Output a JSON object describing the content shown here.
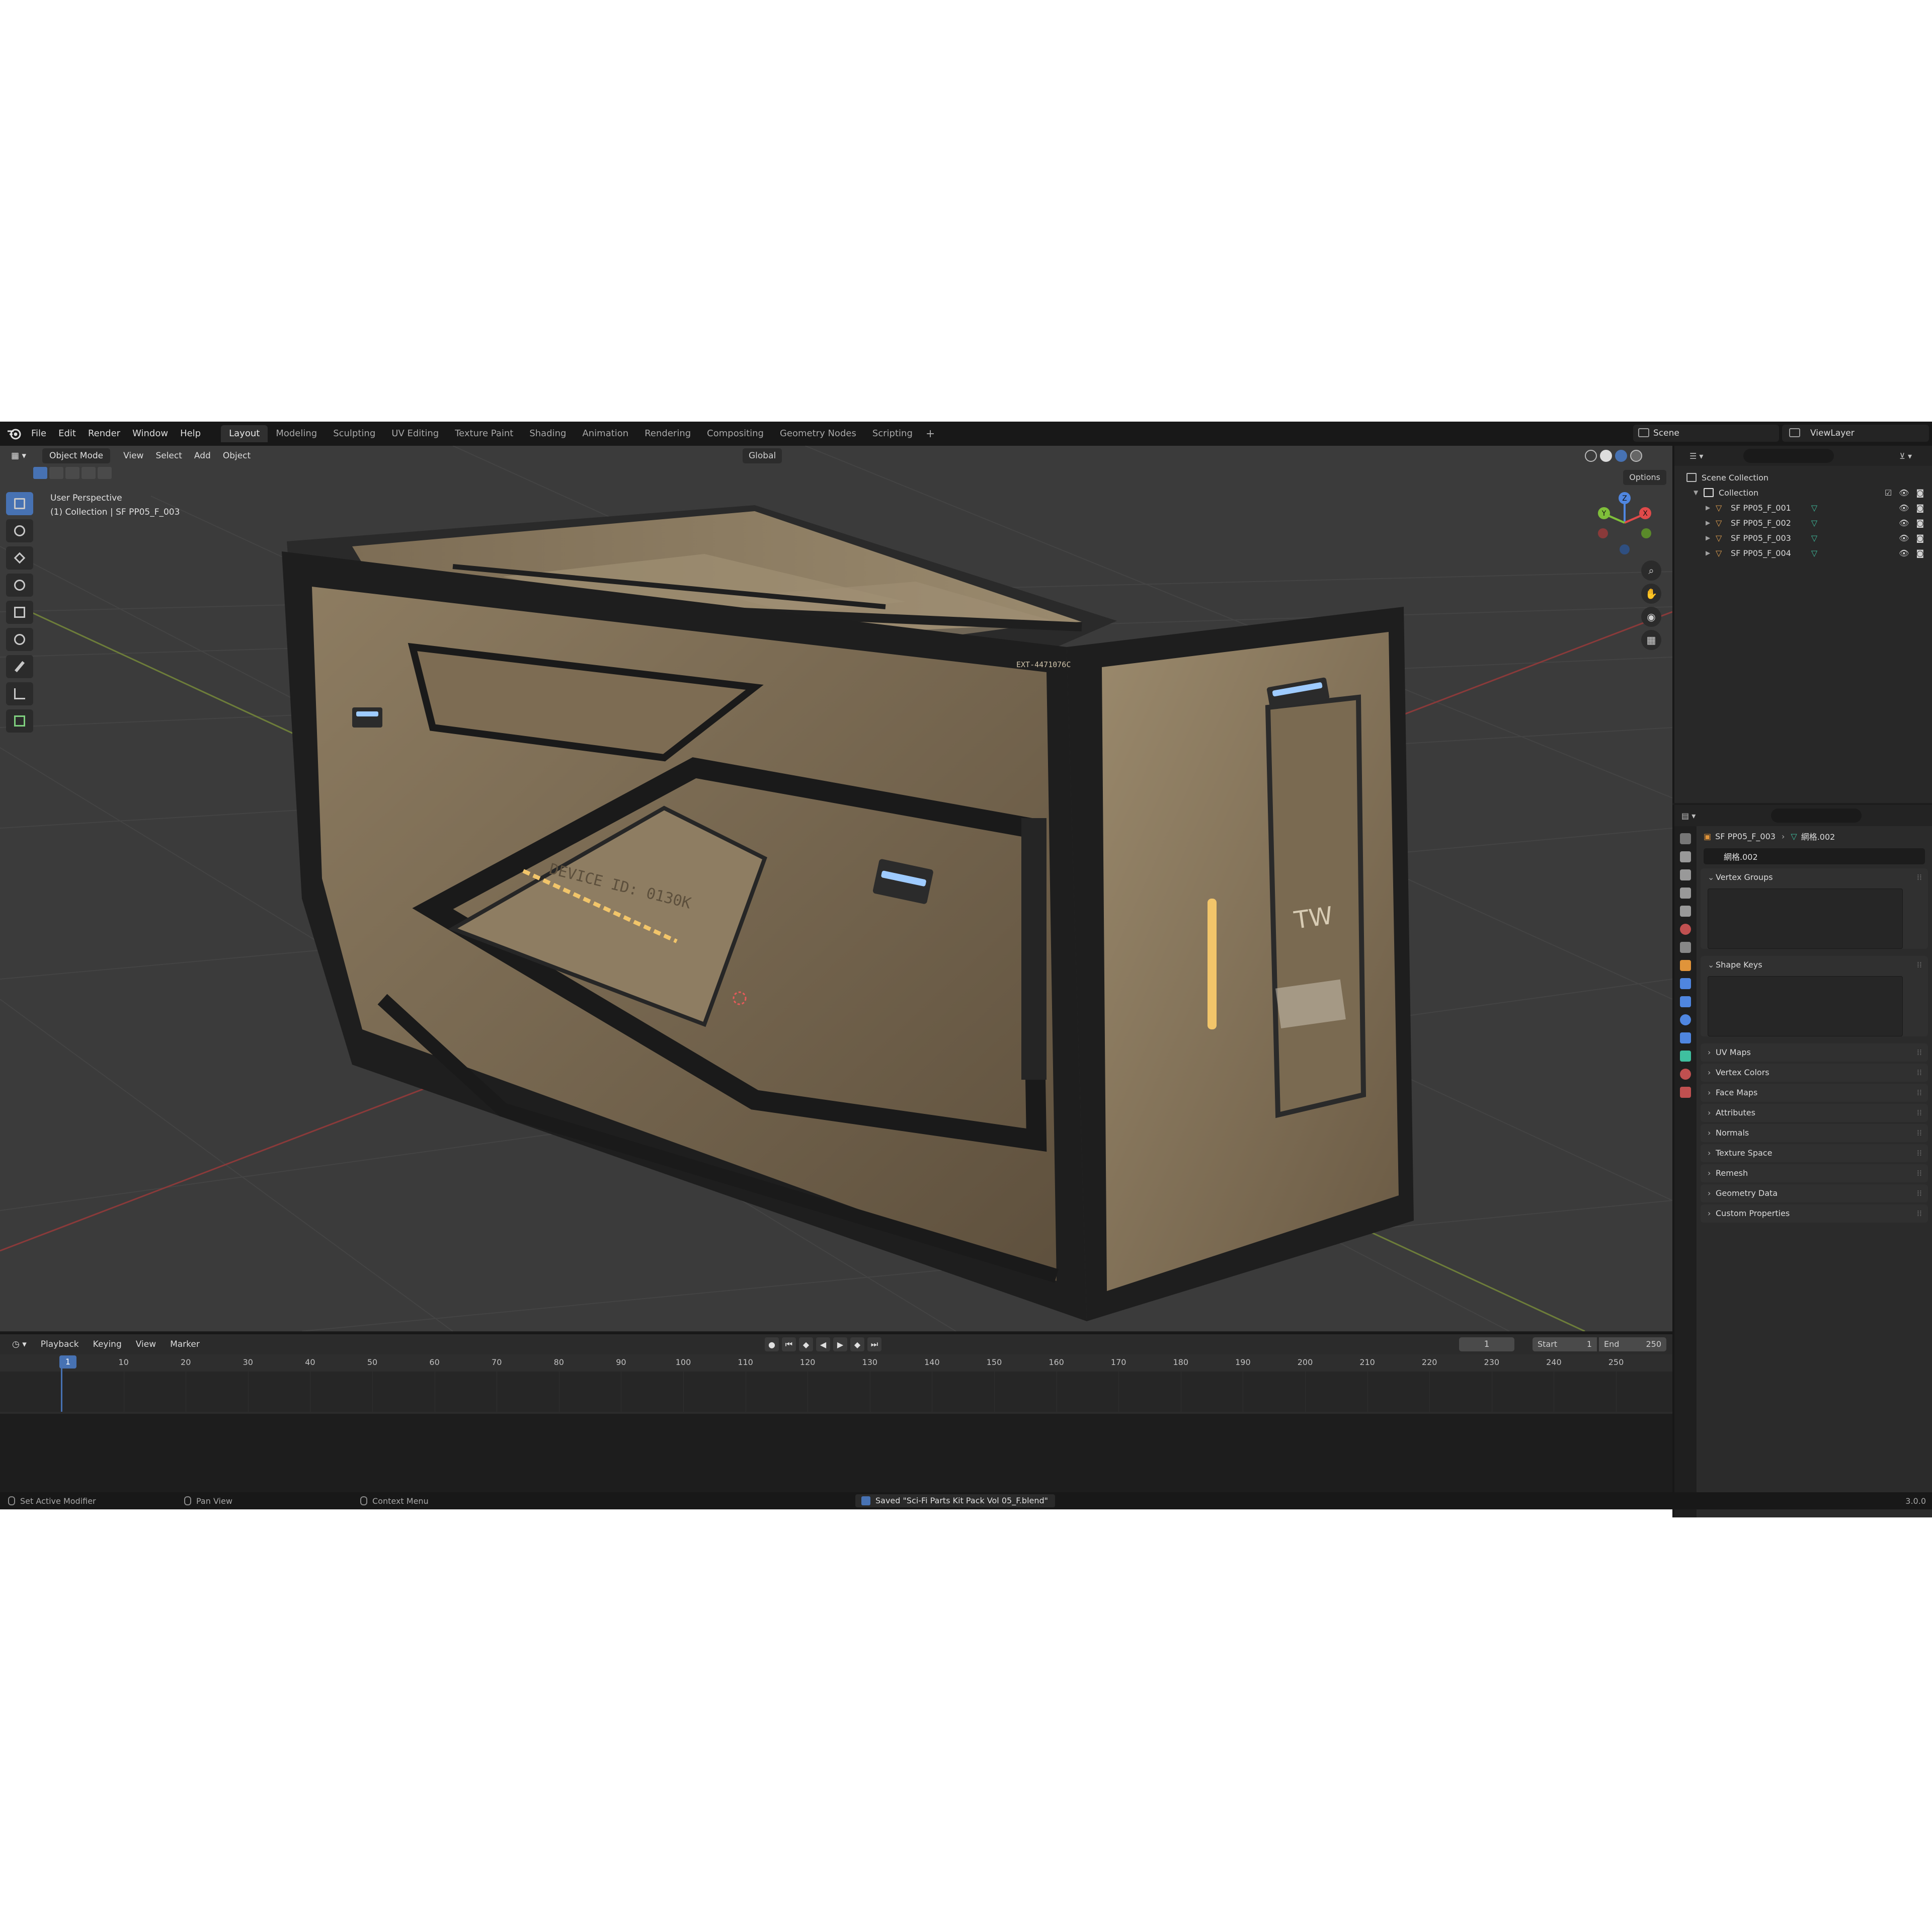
{
  "app": {
    "menu": [
      "File",
      "Edit",
      "Render",
      "Window",
      "Help"
    ],
    "workspaces": [
      "Layout",
      "Modeling",
      "Sculpting",
      "UV Editing",
      "Texture Paint",
      "Shading",
      "Animation",
      "Rendering",
      "Compositing",
      "Geometry Nodes",
      "Scripting"
    ],
    "active_workspace": "Layout",
    "add_workspace": "+",
    "scene": "Scene",
    "view_layer": "ViewLayer"
  },
  "viewport": {
    "mode": "Object Mode",
    "menus": [
      "View",
      "Select",
      "Add",
      "Object"
    ],
    "orientation": "Global",
    "options": "Options",
    "info_line1": "User Perspective",
    "info_line2": "(1) Collection | SF PP05_F_003",
    "crate_label": "DEVICE ID: 0130K",
    "crate_tag": "TW",
    "crate_serial": "EXT-4471076C",
    "gizmo": {
      "x": "X",
      "y": "Y",
      "z": "Z"
    }
  },
  "outliner": {
    "root": "Scene Collection",
    "collection": "Collection",
    "items": [
      "SF PP05_F_001",
      "SF PP05_F_002",
      "SF PP05_F_003",
      "SF PP05_F_004"
    ]
  },
  "properties": {
    "object": "SF PP05_F_003",
    "mesh": "網格.002",
    "panels_open": [
      "Vertex Groups",
      "Shape Keys"
    ],
    "panels_closed": [
      "UV Maps",
      "Vertex Colors",
      "Face Maps",
      "Attributes",
      "Normals",
      "Texture Space",
      "Remesh",
      "Geometry Data",
      "Custom Properties"
    ]
  },
  "timeline": {
    "menus": [
      "Playback",
      "Keying",
      "View",
      "Marker"
    ],
    "current_frame": "1",
    "start_label": "Start",
    "start": "1",
    "end_label": "End",
    "end": "250",
    "ticks": [
      "10",
      "20",
      "30",
      "40",
      "50",
      "60",
      "70",
      "80",
      "90",
      "100",
      "110",
      "120",
      "130",
      "140",
      "150",
      "160",
      "170",
      "180",
      "190",
      "200",
      "210",
      "220",
      "230",
      "240",
      "250"
    ]
  },
  "statusbar": {
    "left1": "Set Active Modifier",
    "left2": "Pan View",
    "left3": "Context Menu",
    "message": "Saved \"Sci-Fi Parts Kit Pack Vol 05_F.blend\"",
    "version": "3.0.0"
  },
  "colors": {
    "accent": "#4772b3",
    "viewport_bg": "#3b3b3b",
    "crate_tan": "#8c7a5e",
    "frame_dark": "#1e1e1e",
    "light_blue": "#9ecbff",
    "light_amber": "#f2c56a"
  }
}
